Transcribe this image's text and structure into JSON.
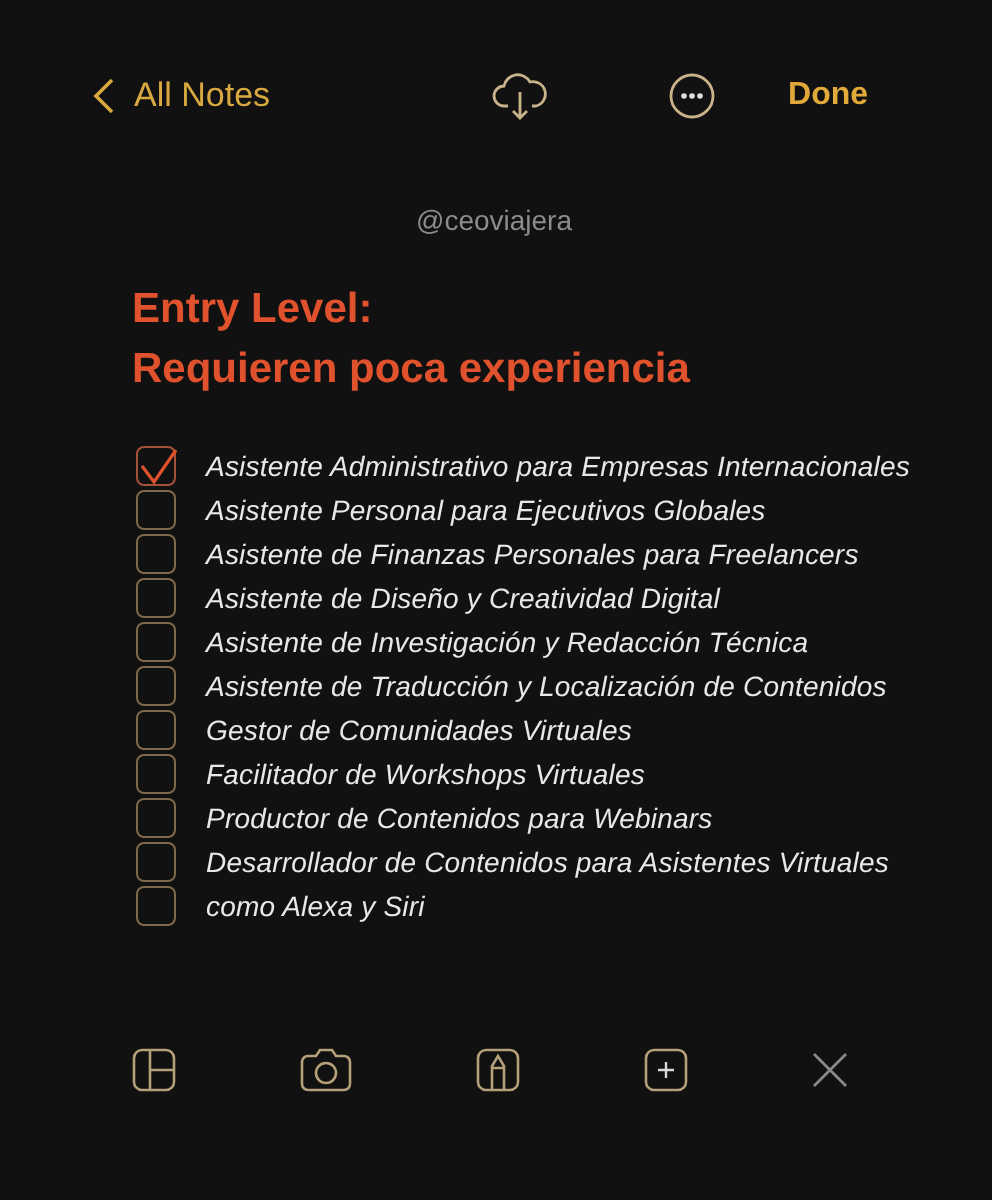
{
  "nav": {
    "back": "All Notes",
    "done": "Done"
  },
  "handle": "@ceoviajera",
  "title": [
    "Entry Level:",
    "Requieren poca experiencia"
  ],
  "checklist": [
    {
      "text": "Asistente Administrativo para Empresas Internacionales",
      "checked": true
    },
    {
      "text": "Asistente Personal para Ejecutivos Globales",
      "checked": false
    },
    {
      "text": "Asistente de Finanzas Personales para Freelancers",
      "checked": false
    },
    {
      "text": "Asistente de Diseño y Creatividad Digital",
      "checked": false
    },
    {
      "text": "Asistente de Investigación y Redacción Técnica",
      "checked": false
    },
    {
      "text": "Asistente de Traducción y Localización de Contenidos",
      "checked": false
    },
    {
      "text": "Gestor de Comunidades Virtuales",
      "checked": false
    },
    {
      "text": "Facilitador de Workshops Virtuales",
      "checked": false
    },
    {
      "text": "Productor de Contenidos para Webinars",
      "checked": false
    },
    {
      "text": "Desarrollador de Contenidos para Asistentes Virtuales",
      "checked": false
    },
    {
      "text": "como Alexa y Siri",
      "checked": false
    }
  ]
}
